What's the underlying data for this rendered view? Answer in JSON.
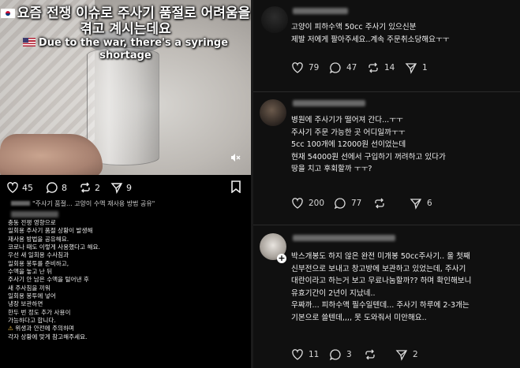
{
  "left": {
    "video": {
      "caption_ko": "요즘 전쟁 이슈로 주사기 품절로 어려움을 겪고 계시는데요",
      "caption_en": "Due to the war, there's a syringe shortage",
      "mute_icon": "speaker-muted-icon"
    },
    "actions": {
      "likes": "45",
      "comments": "8",
      "reposts": "2",
      "shares": "9"
    },
    "reply_preview": "\"주사기 품절... 고양이 수액 재사용 방법 공유\"",
    "body_lines": [
      "충동 전쟁 영향으로",
      "일회용 주사기 품절 상황이 발생해",
      "재사용 방법을 공유해요.",
      "코로나 때도 이렇게 사용했다고 해요.",
      "우선 새 일회용 수사침과",
      "일회용 봉투를 준비하고,",
      "수액을 놓고 난 뒤",
      "주사기 안 남은 수액을 털어낸 후",
      "새 주사침을 끼워",
      "일회용 봉투에 넣어",
      "냉장 보관하면",
      "한두 번 정도 추가 사용이",
      "가능하다고 합니다.",
      "위생과 안전에 주의하며",
      "각자 상황에 맞게 참고해주세요."
    ],
    "warning_icon": "warning-icon"
  },
  "right": {
    "posts": [
      {
        "lines": [
          "고양이 피하수액 50cc 주사기 있으신분",
          "제발 저에게 팔아주세요..계속 주문취소당해요ㅜㅜ"
        ],
        "likes": "79",
        "comments": "47",
        "reposts": "14",
        "shares": "1"
      },
      {
        "lines": [
          "병원에 주사기가 떨어져 간다...ㅜㅜ",
          "주사기 주문 가능한 곳 어디일까ㅜㅜ",
          "5cc 100개에 12000원 선이었는데",
          "현재 54000원 선에서 구입하기 꺼려하고 있다가",
          "땅을 치고 후회할까 ㅜㅜ?"
        ],
        "likes": "200",
        "comments": "77",
        "reposts": "",
        "shares": "6"
      },
      {
        "lines": [
          "박스개봉도 하지 않은 완전 미개봉 50cc주사기.. 울 첫째",
          "신부전으로 보내고 창고방에 보관하고 있었는데, 주사기",
          "대란이라고 하는거 보고 무료나눔할까?? 하며 확인해보니",
          "유효기간이 2년이 지났네..",
          "우짜까... 피하수액 필수일텐데... 주사기 하루에 2-3개는",
          "기본으로 쓸텐데,,,, 못 도와줘서 미안해요.."
        ],
        "likes": "11",
        "comments": "3",
        "reposts": "",
        "shares": "2"
      }
    ]
  },
  "colors": {
    "background": "#000000",
    "panel_right": "#101010",
    "text": "#f0f0f0",
    "muted": "#d8d8d8",
    "warning": "#f6c342"
  }
}
